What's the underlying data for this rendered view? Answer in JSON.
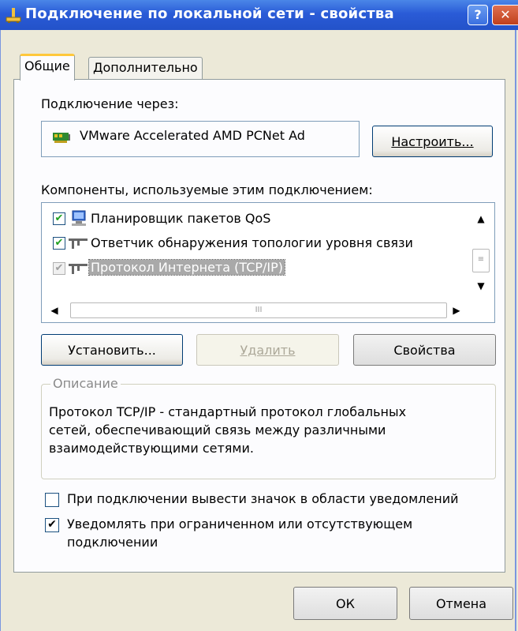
{
  "window": {
    "title": "Подключение по локальной сети - свойства",
    "help_glyph": "?",
    "close_glyph": "✕"
  },
  "tabs": [
    {
      "label": "Общие",
      "active": true
    },
    {
      "label": "Дополнительно",
      "active": false
    }
  ],
  "connect": {
    "label": "Подключение через:",
    "adapter": "VMware Accelerated AMD PCNet Ad",
    "configure_button": "Настроить..."
  },
  "components": {
    "label": "Компоненты, используемые этим подключением:",
    "items": [
      {
        "label": "Планировщик пакетов QoS",
        "checked": true,
        "icon": "qos-scheduler-icon"
      },
      {
        "label": "Ответчик обнаружения топологии уровня связи",
        "checked": true,
        "icon": "network-protocol-icon"
      },
      {
        "label": "Протокол Интернета (TCP/IP)",
        "checked": true,
        "selected": true,
        "icon": "network-protocol-icon"
      }
    ],
    "hscroll_grip": "III"
  },
  "buttons": {
    "install": "Установить...",
    "remove": "Удалить",
    "properties": "Свойства"
  },
  "description": {
    "legend": "Описание",
    "lines": [
      "Протокол TCP/IP - стандартный протокол глобальных",
      "сетей, обеспечивающий связь между различными",
      "взаимодействующими сетями."
    ]
  },
  "options": {
    "show_icon": {
      "label": "При подключении вывести значок в области уведомлений",
      "checked": false
    },
    "notify_limited": {
      "line1": "Уведомлять при ограниченном или отсутствующем",
      "line2": "подключении",
      "checked": true
    }
  },
  "footer": {
    "ok": "ОК",
    "cancel": "Отмена"
  },
  "colors": {
    "titlebar": "#2a5bd7",
    "dialog_bg": "#ece9d8",
    "check": "#21a121",
    "selected_bg": "#a9a9a9"
  }
}
